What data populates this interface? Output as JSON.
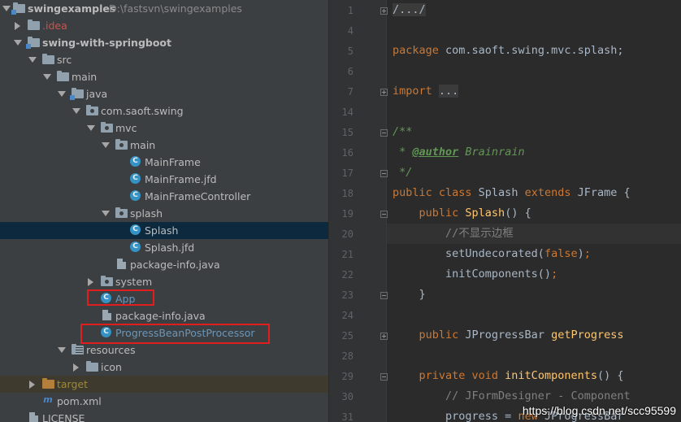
{
  "project_tree": {
    "root": {
      "name": "swingexamples",
      "path": "D:\\fastsvn\\swingexamples"
    },
    "items": [
      {
        "label": ".idea",
        "style": "red",
        "icon": "folder-icon"
      },
      {
        "label": "swing-with-springboot",
        "style": "bold",
        "icon": "module-folder-icon"
      },
      {
        "label": "src",
        "icon": "folder-icon"
      },
      {
        "label": "main",
        "icon": "folder-icon"
      },
      {
        "label": "java",
        "icon": "source-folder-icon"
      },
      {
        "label": "com.saoft.swing",
        "icon": "package-icon"
      },
      {
        "label": "mvc",
        "icon": "package-icon"
      },
      {
        "label": "main",
        "icon": "package-icon"
      },
      {
        "label": "MainFrame",
        "icon": "class-icon"
      },
      {
        "label": "MainFrame.jfd",
        "icon": "class-icon"
      },
      {
        "label": "MainFrameController",
        "icon": "class-icon"
      },
      {
        "label": "splash",
        "icon": "package-icon"
      },
      {
        "label": "Splash",
        "icon": "class-icon"
      },
      {
        "label": "Splash.jfd",
        "icon": "class-icon"
      },
      {
        "label": "package-info.java",
        "icon": "package-info-icon"
      },
      {
        "label": "system",
        "icon": "package-icon"
      },
      {
        "label": "App",
        "icon": "app-class-icon",
        "style": "blue"
      },
      {
        "label": "package-info.java",
        "icon": "package-info-icon"
      },
      {
        "label": "ProgressBeanPostProcessor",
        "icon": "class-icon",
        "style": "blue"
      },
      {
        "label": "resources",
        "icon": "resources-folder-icon"
      },
      {
        "label": "icon",
        "icon": "folder-icon"
      },
      {
        "label": "target",
        "style": "olive",
        "icon": "excluded-folder-icon"
      },
      {
        "label": "pom.xml",
        "icon": "maven-file-icon"
      },
      {
        "label": "LICENSE",
        "icon": "file-icon"
      }
    ]
  },
  "editor": {
    "line_numbers": [
      "1",
      "4",
      "5",
      "6",
      "7",
      "14",
      "15",
      "16",
      "17",
      "18",
      "19",
      "20",
      "21",
      "22",
      "23",
      "24",
      "25",
      "28",
      "29",
      "30",
      "31"
    ],
    "code": {
      "l1": "/.../",
      "l5_kw": "package",
      "l5_rest": " com.saoft.swing.mvc.splash;",
      "l7_kw": "import",
      "l7_fold": "...",
      "l15": "/**",
      "l16_star": " * ",
      "l16_tag": "@author",
      "l16_name": " Brainrain",
      "l17": " */",
      "l18_kw1": "public class",
      "l18_name": " Splash ",
      "l18_kw2": "extends",
      "l18_rest": " JFrame {",
      "l19_kw": "    public",
      "l19_fn": " Splash",
      "l19_rest": "() {",
      "l20": "        //不显示边框",
      "l21_a": "        setUndecorated(",
      "l21_kw": "false",
      "l21_b": ")",
      "l21_semi": ";",
      "l22_a": "        initComponents()",
      "l22_semi": ";",
      "l23": "    }",
      "l25_kw": "    public",
      "l25_type": " JProgressBar ",
      "l25_fn": "getProgress",
      "l29_kw": "    private void",
      "l29_fn": " initComponents",
      "l29_rest": "() {",
      "l30": "        // JFormDesigner - Component",
      "l31_a": "        progress = ",
      "l31_kw": "new",
      "l31_b": " JProgressBar"
    }
  },
  "watermark": "https://blog.csdn.net/scc95599"
}
